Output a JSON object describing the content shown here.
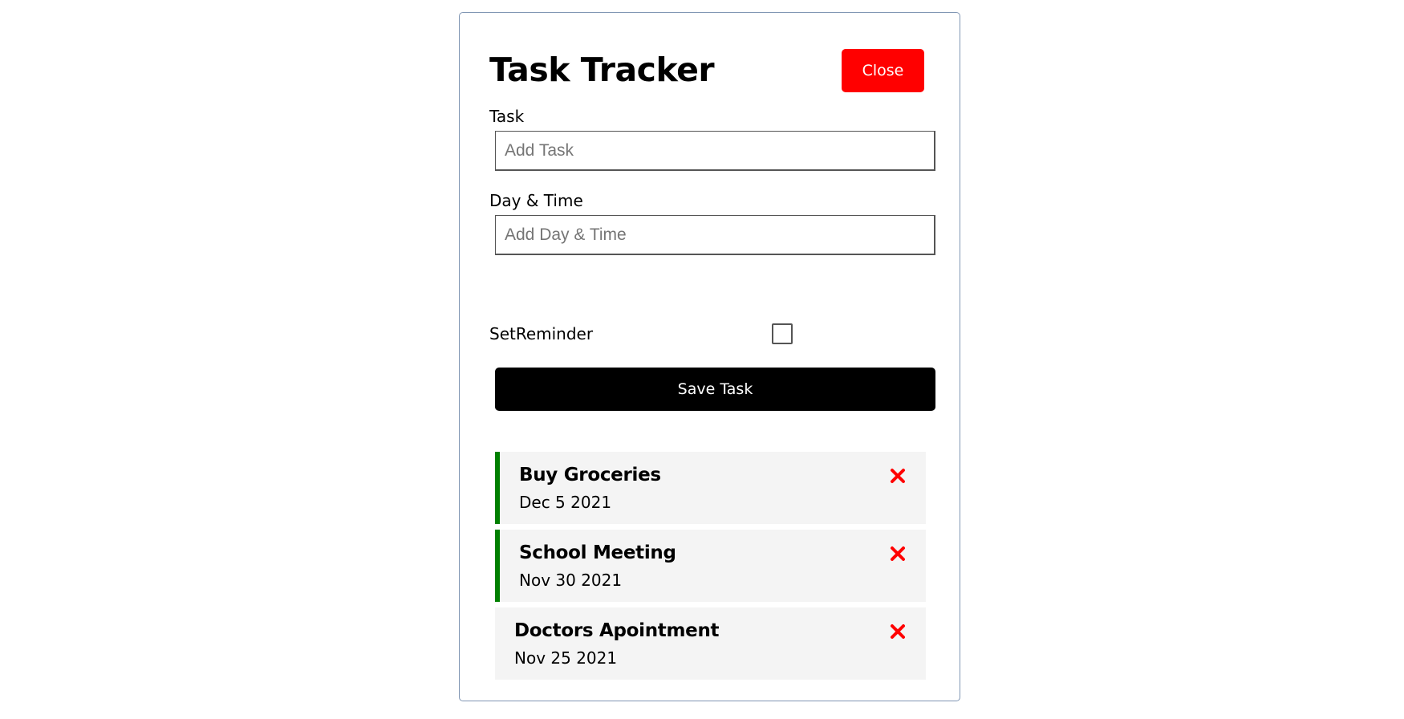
{
  "header": {
    "title": "Task Tracker",
    "close_label": "Close"
  },
  "form": {
    "task_label": "Task",
    "task_placeholder": "Add Task",
    "task_value": "",
    "day_label": "Day & Time",
    "day_placeholder": "Add Day & Time",
    "day_value": "",
    "reminder_label": "SetReminder",
    "reminder_checked": false,
    "save_label": "Save Task"
  },
  "tasks": [
    {
      "text": "Buy Groceries",
      "day": "Dec 5 2021",
      "reminder": true
    },
    {
      "text": "School Meeting",
      "day": "Nov 30 2021",
      "reminder": true
    },
    {
      "text": "Doctors Apointment",
      "day": "Nov 25 2021",
      "reminder": false
    }
  ],
  "icons": {
    "delete": "close-x-icon"
  },
  "colors": {
    "close_button": "#ff0000",
    "save_button": "#000000",
    "reminder_border": "#008000",
    "delete_icon": "#ff0000",
    "task_background": "#f4f4f4",
    "container_border": "#7f95b3"
  }
}
